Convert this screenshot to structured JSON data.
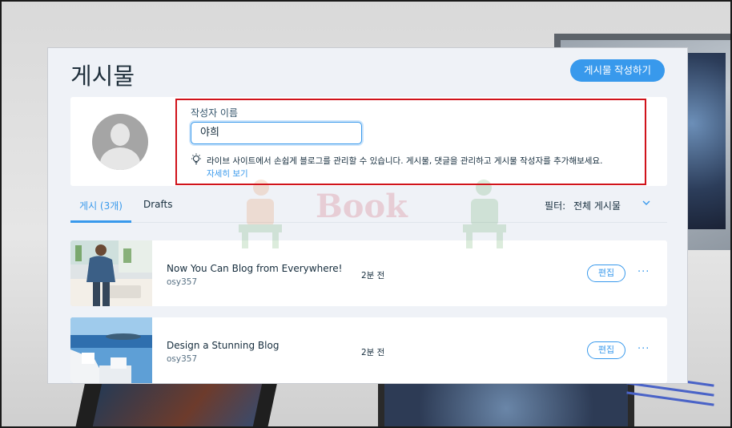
{
  "header": {
    "title": "게시물",
    "create_button": "게시물 작성하기"
  },
  "author": {
    "label": "작성자 이름",
    "value": "야희",
    "tip": "라이브 사이트에서 손쉽게 블로그를 관리할 수 있습니다. 게시물, 댓글을 관리하고 게시물 작성자를 추가해보세요.",
    "tip_link": "자세히 보기"
  },
  "tabs": {
    "posts": "게시 (3개)",
    "drafts": "Drafts"
  },
  "filter": {
    "label": "필터:",
    "value": "전체 게시물"
  },
  "watermark": {
    "text": "Book"
  },
  "posts": [
    {
      "title": "Now You Can Blog from Everywhere!",
      "author": "osy357",
      "time": "2분 전",
      "edit": "편집",
      "more": "···"
    },
    {
      "title": "Design a Stunning Blog",
      "author": "osy357",
      "time": "2분 전",
      "edit": "편집",
      "more": "···"
    }
  ],
  "colors": {
    "accent": "#3899ec",
    "highlight": "#d0131b",
    "panel_bg": "#eff2f7"
  }
}
